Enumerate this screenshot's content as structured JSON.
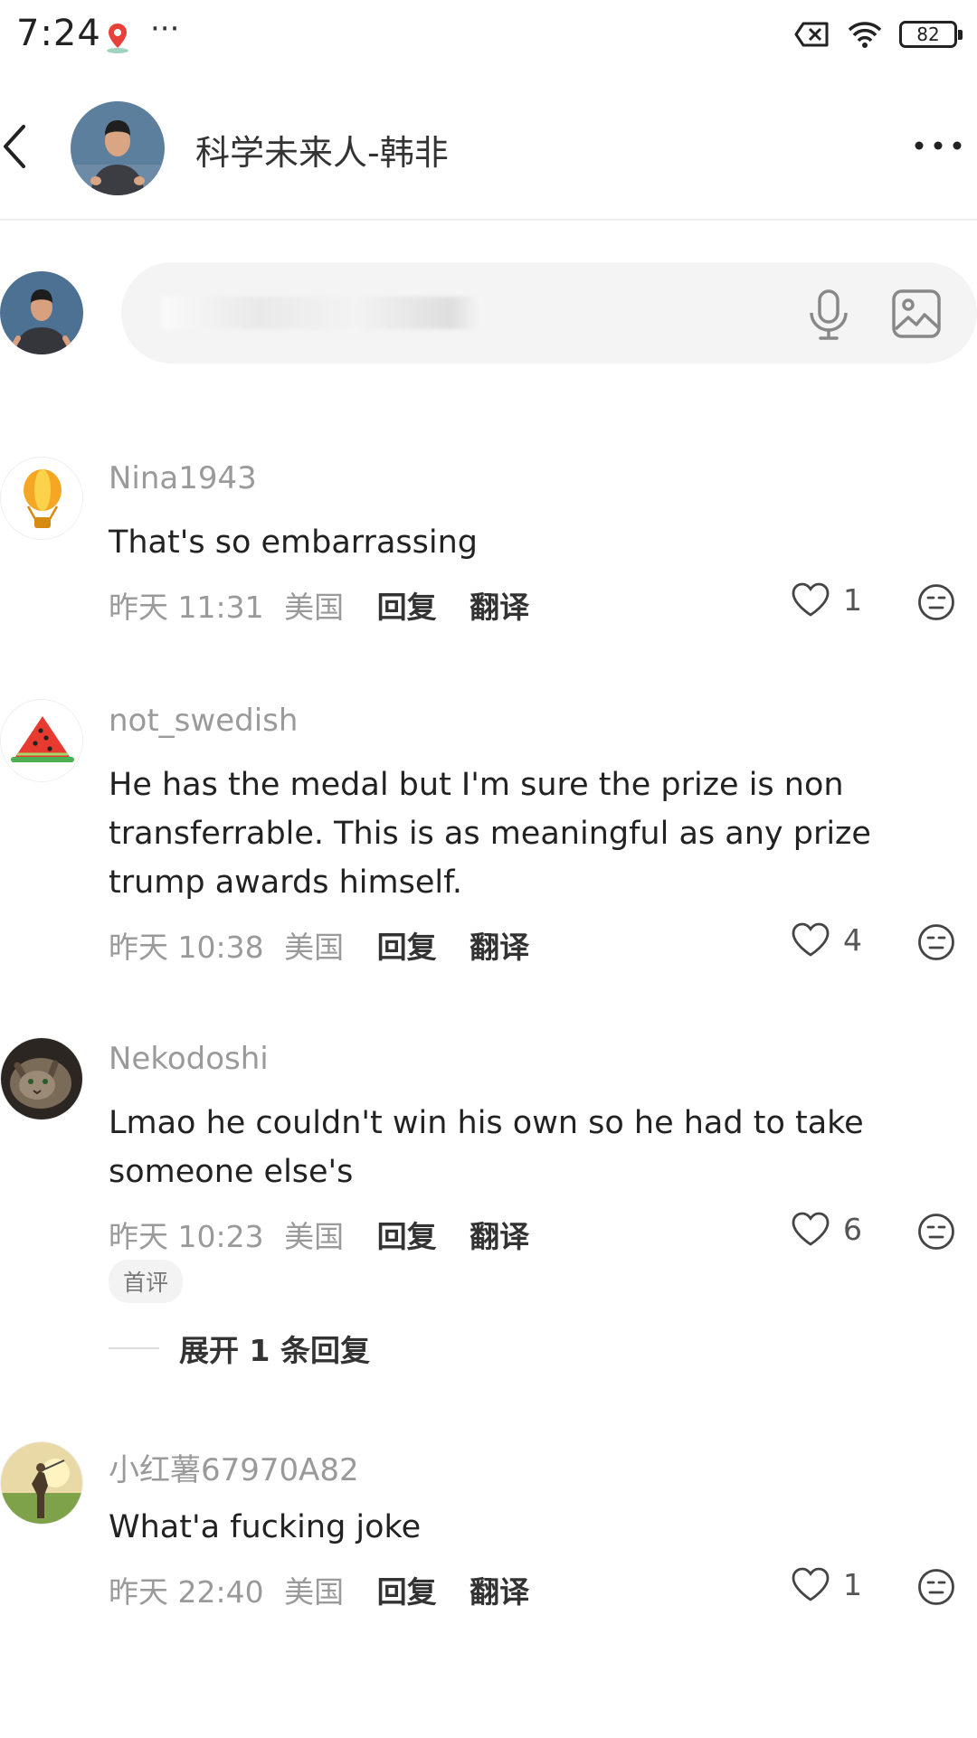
{
  "status_bar": {
    "time": "7:24",
    "battery": "82"
  },
  "header": {
    "title": "科学未来人-韩非"
  },
  "composer": {
    "placeholder": ""
  },
  "comments": [
    {
      "username": "Nina1943",
      "text": "That's so embarrassing",
      "date": "昨天",
      "time": "11:31",
      "location": "美国",
      "reply_label": "回复",
      "translate_label": "翻译",
      "likes": "1"
    },
    {
      "username": "not_swedish",
      "text": "He has the medal but I'm sure the prize is non transferrable. This is as meaningful as any prize trump awards himself.",
      "date": "昨天",
      "time": "10:38",
      "location": "美国",
      "reply_label": "回复",
      "translate_label": "翻译",
      "likes": "4"
    },
    {
      "username": "Nekodoshi",
      "text": "Lmao he couldn't win his own so he had to take someone else's",
      "date": "昨天",
      "time": "10:23",
      "location": "美国",
      "reply_label": "回复",
      "translate_label": "翻译",
      "likes": "6",
      "badge": "首评",
      "expand_label": "展开 1 条回复"
    },
    {
      "username": "小红薯67970A82",
      "text": "What'a fucking joke",
      "date": "昨天",
      "time": "22:40",
      "location": "美国",
      "reply_label": "回复",
      "translate_label": "翻译",
      "likes": "1"
    }
  ],
  "icons": {
    "status_left": [
      "map-pin-icon",
      "more-dots-icon"
    ],
    "status_right": [
      "sim-x-icon",
      "wifi-icon",
      "battery-icon"
    ],
    "header": [
      "back-arrow-icon",
      "more-dots-icon"
    ],
    "composer": [
      "microphone-icon",
      "image-icon"
    ],
    "comment": [
      "heart-icon",
      "emoji-face-icon"
    ]
  },
  "colors": {
    "username": "#9a9a9a",
    "text": "#222222",
    "accent": "#333333",
    "input_bg": "#f4f4f4"
  }
}
